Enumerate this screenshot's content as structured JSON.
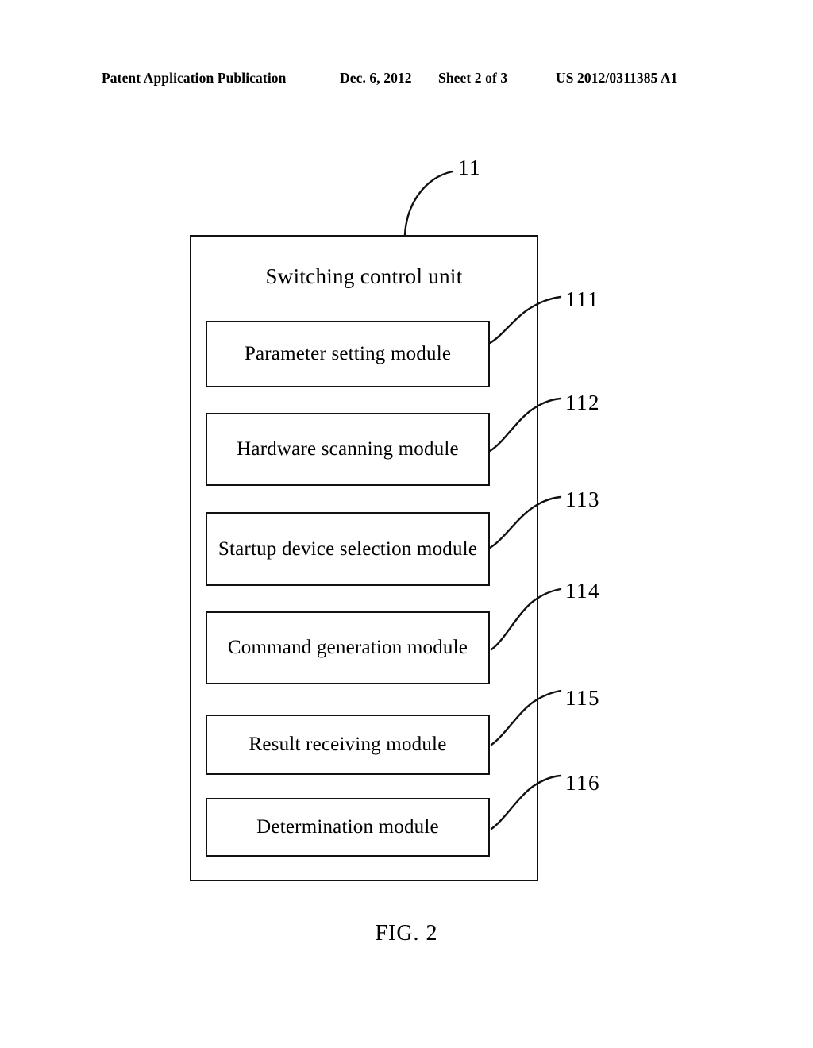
{
  "header": {
    "publication": "Patent Application Publication",
    "date": "Dec. 6, 2012",
    "sheet": "Sheet 2 of 3",
    "patent_number": "US 2012/0311385 A1"
  },
  "figure": {
    "caption": "FIG. 2",
    "unit": {
      "ref": "11",
      "title": "Switching control unit"
    },
    "modules": [
      {
        "ref": "111",
        "label": "Parameter setting module"
      },
      {
        "ref": "112",
        "label": "Hardware scanning module"
      },
      {
        "ref": "113",
        "label": "Startup device selection module"
      },
      {
        "ref": "114",
        "label": "Command generation module"
      },
      {
        "ref": "115",
        "label": "Result receiving module"
      },
      {
        "ref": "116",
        "label": "Determination module"
      }
    ]
  },
  "colors": {
    "ink": "#111111",
    "paper": "#ffffff"
  }
}
